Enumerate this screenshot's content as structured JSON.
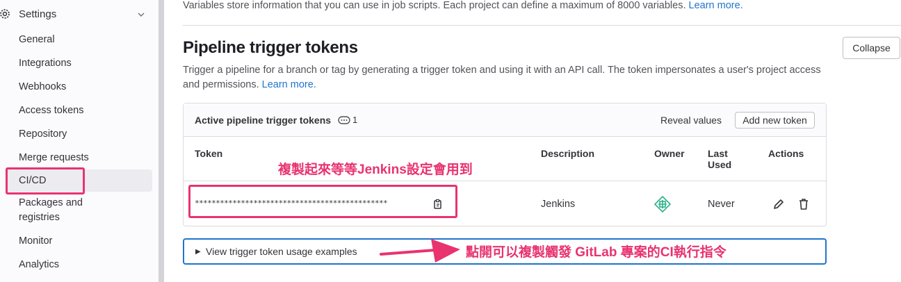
{
  "sidebar": {
    "title": "Settings",
    "items": [
      {
        "label": "General"
      },
      {
        "label": "Integrations"
      },
      {
        "label": "Webhooks"
      },
      {
        "label": "Access tokens"
      },
      {
        "label": "Repository"
      },
      {
        "label": "Merge requests"
      },
      {
        "label": "CI/CD",
        "active": true
      },
      {
        "label": "Packages and\nregistries"
      },
      {
        "label": "Monitor"
      },
      {
        "label": "Analytics"
      }
    ]
  },
  "variables_intro": {
    "text": "Variables store information that you can use in job scripts. Each project can define a maximum of 8000 variables. ",
    "link": "Learn more."
  },
  "section": {
    "title": "Pipeline trigger tokens",
    "description": "Trigger a pipeline for a branch or tag by generating a trigger token and using it with an API call. The token impersonates a user's project access and permissions. ",
    "learn_more": "Learn more.",
    "collapse_label": "Collapse"
  },
  "card": {
    "title": "Active pipeline trigger tokens",
    "count": "1",
    "reveal_label": "Reveal values",
    "add_label": "Add new token",
    "columns": {
      "token": "Token",
      "description": "Description",
      "owner": "Owner",
      "last_used_1": "Last",
      "last_used_2": "Used",
      "actions": "Actions"
    },
    "rows": [
      {
        "token": "**********************************************",
        "description": "Jenkins",
        "last_used": "Never"
      }
    ]
  },
  "details": {
    "summary": "View trigger token usage examples"
  },
  "annotations": {
    "copy_note": "複製起來等等Jenkins設定會用到",
    "open_note": "點開可以複製觸發 GitLab 專案的CI執行指令",
    "color": "#e8336f"
  }
}
